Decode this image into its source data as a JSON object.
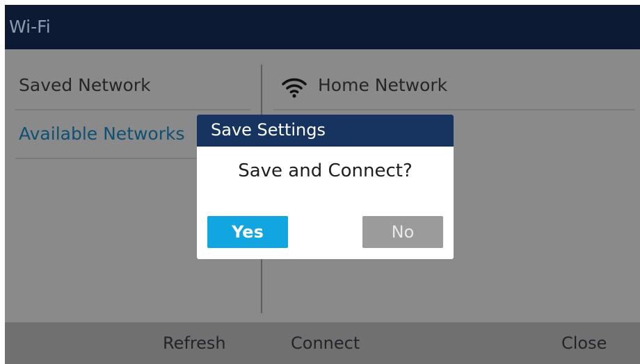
{
  "app": {
    "title": "Wi-Fi"
  },
  "left_menu": {
    "items": [
      {
        "label": "Saved Network"
      },
      {
        "label": "Available Networks"
      }
    ]
  },
  "network_list": {
    "items": [
      {
        "label": "Home Network",
        "icon": "wifi-icon"
      }
    ]
  },
  "dialog": {
    "title": "Save Settings",
    "message": "Save and Connect?",
    "yes_label": "Yes",
    "no_label": "No"
  },
  "softkeys": {
    "refresh": "Refresh",
    "connect": "Connect",
    "close": "Close"
  },
  "colors": {
    "titlebar": "#0c1a33",
    "dialog_header": "#16345f",
    "accent_blue": "#11a6e2",
    "dimmed_background": "#8a8a8a",
    "softkey_bar": "#707070"
  }
}
